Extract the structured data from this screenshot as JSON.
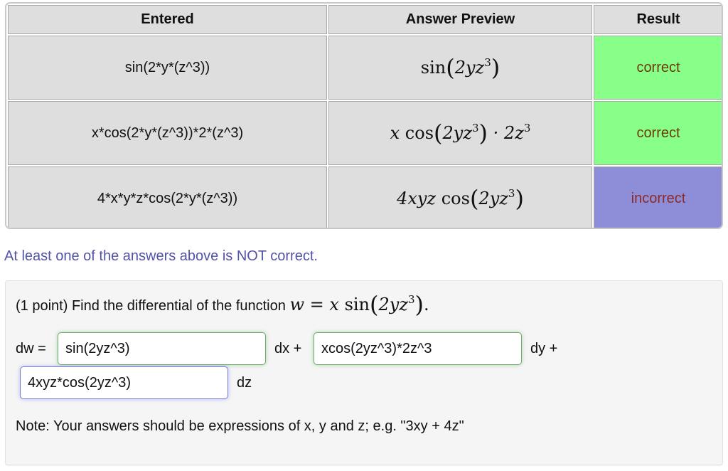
{
  "results_table": {
    "headers": [
      "Entered",
      "Answer Preview",
      "Result"
    ],
    "rows": [
      {
        "entered": "sin(2*y*(z^3))",
        "preview": {
          "pre": "",
          "fn": "sin",
          "arg": "2yz",
          "exp": "3",
          "post": ""
        },
        "result": "correct",
        "status": "correct"
      },
      {
        "entered": "x*cos(2*y*(z^3))*2*(z^3)",
        "preview": {
          "pre": "x",
          "fn": "cos",
          "arg": "2yz",
          "exp": "3",
          "post": "· 2z",
          "post_exp": "3"
        },
        "result": "correct",
        "status": "correct"
      },
      {
        "entered": "4*x*y*z*cos(2*y*(z^3))",
        "preview": {
          "pre": "4xyz",
          "fn": "cos",
          "arg": "2yz",
          "exp": "3",
          "post": ""
        },
        "result": "incorrect",
        "status": "incorrect"
      }
    ],
    "colors": {
      "correct": "#88ff88",
      "incorrect": "#8e8ed8",
      "cell": "#dedede"
    }
  },
  "summary_message": "At least one of the answers above is NOT correct.",
  "problem": {
    "points": "(1 point)",
    "prompt": "Find the differential of the function",
    "function": {
      "lhs": "w",
      "eq": "=",
      "pre": "x",
      "fn": "sin",
      "arg": "2yz",
      "exp": "3",
      "end": "."
    },
    "dw_label": "dw =",
    "dx_label": "dx +",
    "dy_label": "dy +",
    "dz_label": "dz",
    "answers": {
      "dx": "sin(2yz^3)",
      "dy": "xcos(2yz^3)*2z^3",
      "dz": "4xyz*cos(2yz^3)"
    },
    "note": "Note: Your answers should be expressions of x, y and z; e.g. \"3xy + 4z\""
  }
}
